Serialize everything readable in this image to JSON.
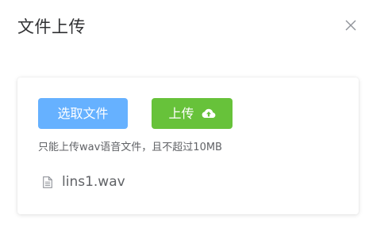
{
  "dialog": {
    "title": "文件上传",
    "close_icon": "close-icon"
  },
  "upload": {
    "select_label": "选取文件",
    "upload_label": "上传",
    "upload_icon": "cloud-upload-icon",
    "tip": "只能上传wav语音文件，且不超过10MB"
  },
  "files": [
    {
      "name": "lins1.wav",
      "icon": "document-icon"
    }
  ],
  "colors": {
    "select_button": "#66b1ff",
    "upload_button": "#67c23a",
    "title_text": "#303133",
    "secondary_text": "#606266",
    "close_icon": "#909399"
  }
}
